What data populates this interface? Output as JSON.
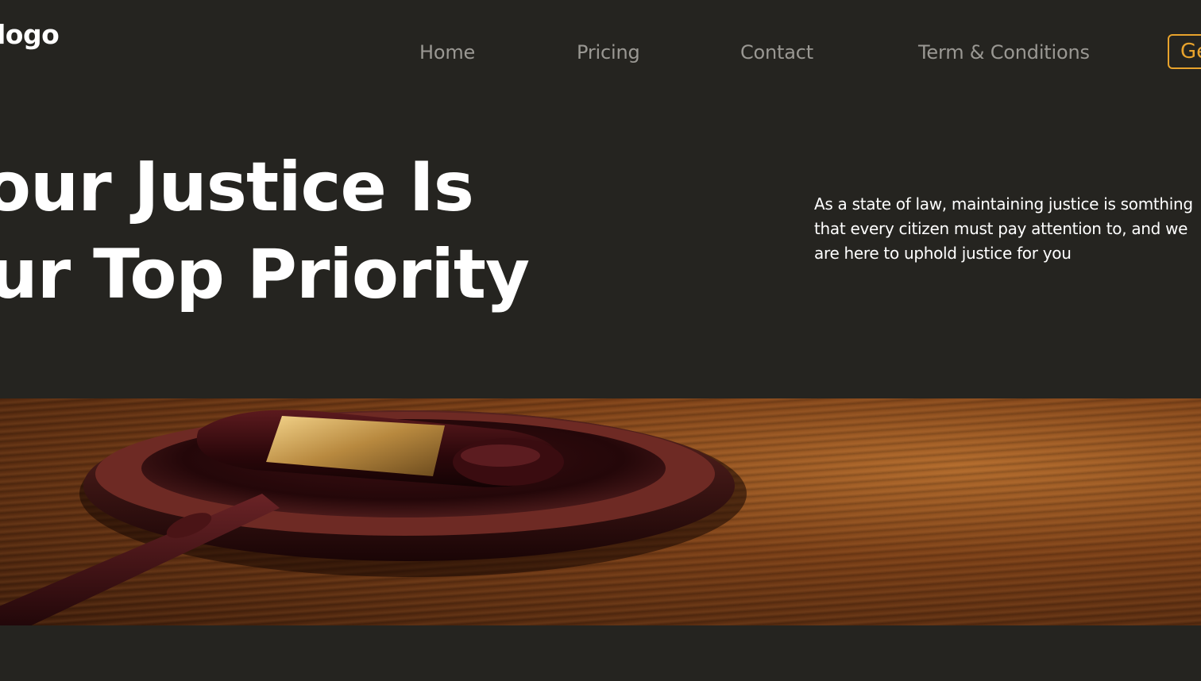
{
  "header": {
    "logo_text": "logo",
    "nav": [
      {
        "label": "Home"
      },
      {
        "label": "Pricing"
      },
      {
        "label": "Contact"
      },
      {
        "label": "Term & Conditions"
      }
    ],
    "cta_label": "Ge"
  },
  "hero": {
    "title_line_1": "Your Justice Is",
    "title_line_2": "Our Top Priority",
    "description": "As a state of law, maintaining justice is somthing that every citizen must pay attention to, and we are here to uphold justice for you"
  },
  "banner": {
    "image_subject": "gavel-on-sound-block"
  },
  "colors": {
    "background": "#252420",
    "accent": "#e8a32c",
    "nav_text": "#9a9893",
    "heading_text": "#ffffff"
  }
}
